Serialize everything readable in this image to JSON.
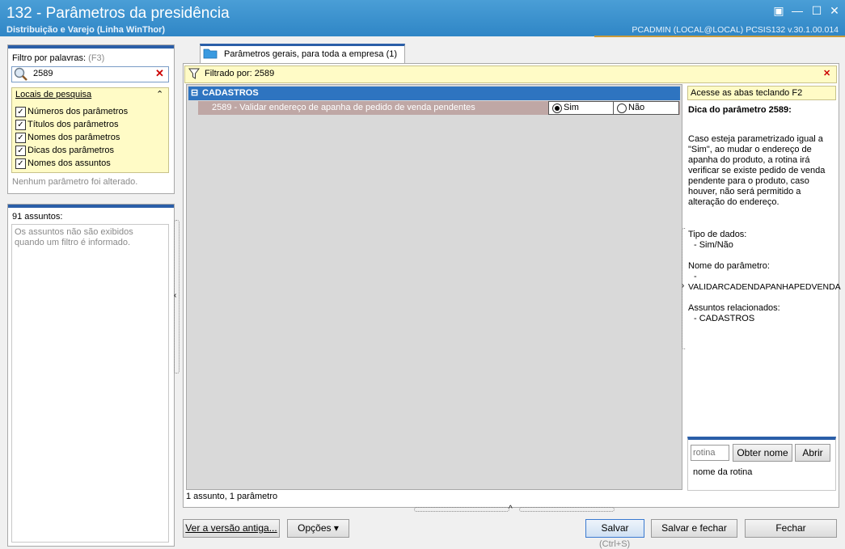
{
  "window": {
    "title": "132 - Parâmetros da presidência",
    "subtitle": "Distribuição e Varejo (Linha WinThor)",
    "user_info": "PCADMIN (LOCAL@LOCAL)   PCSIS132  v.30.1.00.014",
    "controls": {
      "restore": "▣",
      "minimize": "—",
      "maximize": "☐",
      "close": "✕"
    }
  },
  "filter": {
    "label": "Filtro por palavras:",
    "shortcut": "(F3)",
    "value": "2589",
    "search_locations_title": "Locais de pesquisa",
    "options": [
      {
        "label": "Números dos parâmetros",
        "checked": true
      },
      {
        "label": "Títulos dos parâmetros",
        "checked": true
      },
      {
        "label": "Nomes dos parâmetros",
        "checked": true
      },
      {
        "label": "Dicas dos parâmetros",
        "checked": true
      },
      {
        "label": "Nomes dos assuntos",
        "checked": true
      }
    ],
    "status": "Nenhum parâmetro foi alterado."
  },
  "subjects": {
    "count_label": "91 assuntos:",
    "message": "Os assuntos não são exibidos quando um filtro é informado."
  },
  "tab": {
    "label": "Parâmetros gerais, para toda a empresa",
    "count": "(1)"
  },
  "filterbar": {
    "text": "Filtrado por: 2589"
  },
  "grid": {
    "group": {
      "toggle": "⊟",
      "label": "CADASTROS"
    },
    "row": {
      "label": "2589 - Validar endereço de apanha de pedido de venda pendentes",
      "opt_yes": "Sim",
      "opt_no": "Não",
      "selected": "Sim"
    },
    "footer": "1 assunto, 1 parâmetro"
  },
  "hint": {
    "tabs_hint": "Acesse as abas teclando F2",
    "title": "Dica do parâmetro 2589:",
    "description": "Caso esteja parametrizado igual a \"Sim\", ao mudar o endereço de apanha do produto, a rotina irá verificar se existe pedido de venda pendente para o produto, caso houver, não será permitido a alteração do endereço.",
    "data_type_label": "Tipo de dados:",
    "data_type_value": "- Sim/Não",
    "param_name_label": "Nome do parâmetro:",
    "param_name_dash": "-",
    "param_name_value": "VALIDARCADENDAPANHAPEDVENDA",
    "related_label": "Assuntos relacionados:",
    "related_value": "- CADASTROS"
  },
  "routine": {
    "placeholder": "rotina",
    "get_name_label": "Obter nome",
    "open_label": "Abrir",
    "name_label": "nome da rotina"
  },
  "buttons": {
    "old_version": "Ver a versão antiga...",
    "options": "Opções ▾",
    "save": "Salvar",
    "save_shortcut": "(Ctrl+S)",
    "save_close": "Salvar e fechar",
    "close": "Fechar"
  }
}
